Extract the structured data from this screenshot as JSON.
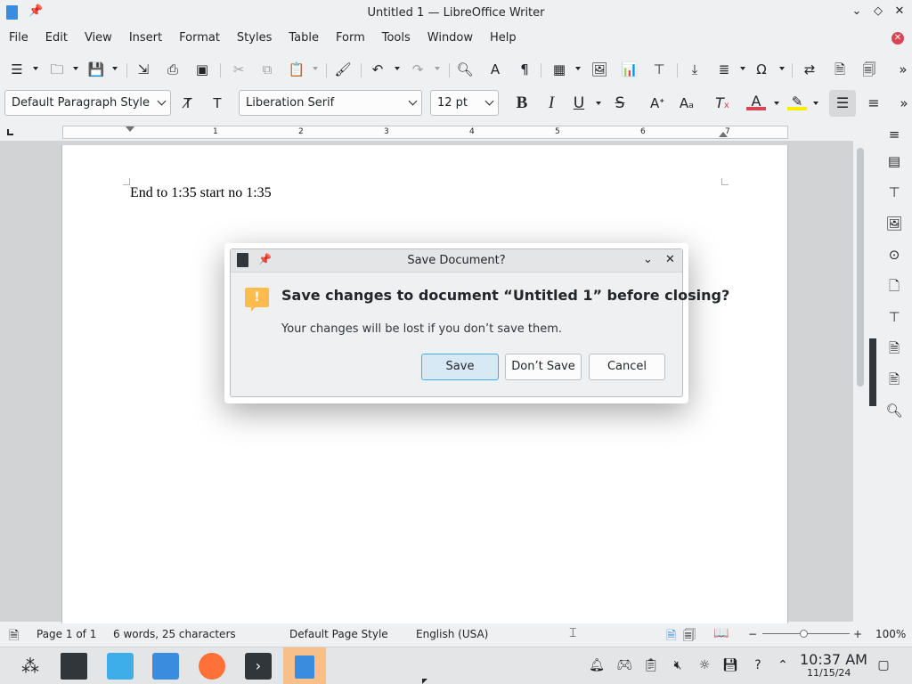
{
  "window": {
    "title": "Untitled 1 — LibreOffice Writer"
  },
  "menubar": [
    "File",
    "Edit",
    "View",
    "Insert",
    "Format",
    "Styles",
    "Table",
    "Form",
    "Tools",
    "Window",
    "Help"
  ],
  "formatting": {
    "paragraph_style": "Default Paragraph Style",
    "font_name": "Liberation Serif",
    "font_size": "12 pt"
  },
  "ruler": {
    "numbers": [
      "1",
      "2",
      "3",
      "4",
      "5",
      "6",
      "7"
    ]
  },
  "document": {
    "text": "End to 1:35 start no 1:35"
  },
  "dialog": {
    "title": "Save Document?",
    "heading": "Save changes to document “Untitled 1” before closing?",
    "message": "Your changes will be lost if you don’t save them.",
    "buttons": {
      "save": "Save",
      "dont_save": "Don’t Save",
      "cancel": "Cancel"
    }
  },
  "statusbar": {
    "page": "Page 1 of 1",
    "words": "6 words, 25 characters",
    "page_style": "Default Page Style",
    "language": "English (USA)",
    "zoom_minus": "−",
    "zoom_plus": "+",
    "zoom": "100%"
  },
  "taskbar": {
    "time": "10:37 AM",
    "date": "11/15/24"
  },
  "colors": {
    "accent": "#3daee9",
    "active_task": "#f7c08a",
    "warning_icon": "#fdbc4b"
  }
}
